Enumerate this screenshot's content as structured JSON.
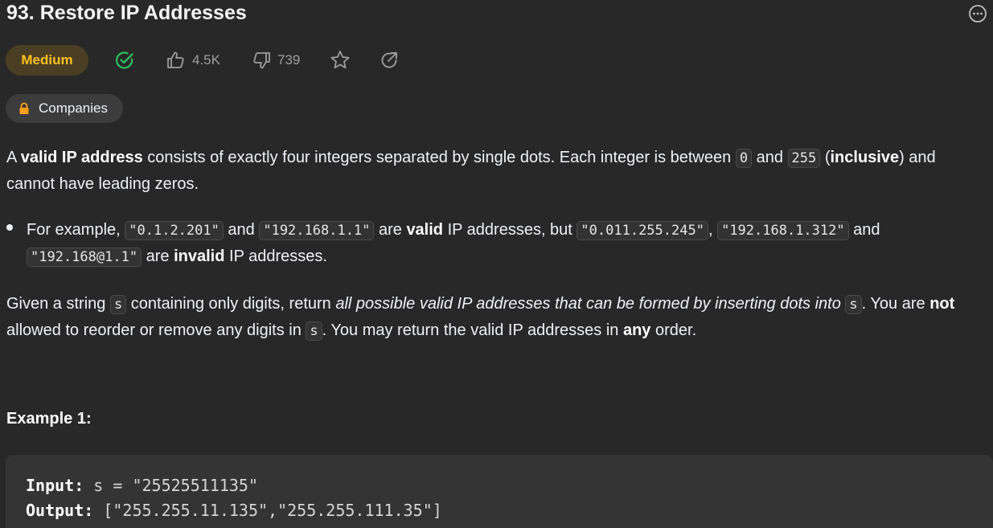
{
  "problem": {
    "title": "93. Restore IP Addresses",
    "difficulty": "Medium",
    "likes": "4.5K",
    "dislikes": "739",
    "companies_label": "Companies"
  },
  "description": {
    "p1": {
      "t1": "A ",
      "b1": "valid IP address",
      "t2": " consists of exactly four integers separated by single dots. Each integer is between ",
      "c1": "0",
      "t3": " and ",
      "c2": "255",
      "t4": " (",
      "b2": "inclusive",
      "t5": ") and cannot have leading zeros."
    },
    "bullet": {
      "t1": "For example, ",
      "c1": "\"0.1.2.201\"",
      "t2": " and ",
      "c2": "\"192.168.1.1\"",
      "t3": " are ",
      "b1": "valid",
      "t4": " IP addresses, but ",
      "c3": "\"0.011.255.245\"",
      "t5": ", ",
      "c4": "\"192.168.1.312\"",
      "t6": " and ",
      "c5": "\"192.168@1.1\"",
      "t7": " are ",
      "b2": "invalid",
      "t8": " IP addresses."
    },
    "p3": {
      "t1": "Given a string ",
      "c1": "s",
      "t2": " containing only digits, return ",
      "i1": "all possible valid IP addresses that can be formed by inserting dots into",
      "t3": " ",
      "c2": "s",
      "t4": ". You are ",
      "b1": "not",
      "t5": " allowed to reorder or remove any digits in ",
      "c3": "s",
      "t6": ". You may return the valid IP addresses in ",
      "b2": "any",
      "t7": " order."
    }
  },
  "example1": {
    "heading": "Example 1:",
    "input_label": "Input:",
    "input_value": " s = \"25525511135\"",
    "output_label": "Output:",
    "output_value": " [\"255.255.11.135\",\"255.255.111.35\"]"
  },
  "icons": {
    "more": "more-options-icon",
    "solved": "solved-check-icon",
    "like": "thumbs-up-icon",
    "dislike": "thumbs-down-icon",
    "star": "star-icon",
    "share": "share-icon",
    "lock": "lock-icon"
  },
  "colors": {
    "background": "#282828",
    "difficulty_medium": "#ffc01e",
    "solved_green": "#2cbb5d",
    "muted": "#9e9e9e"
  }
}
